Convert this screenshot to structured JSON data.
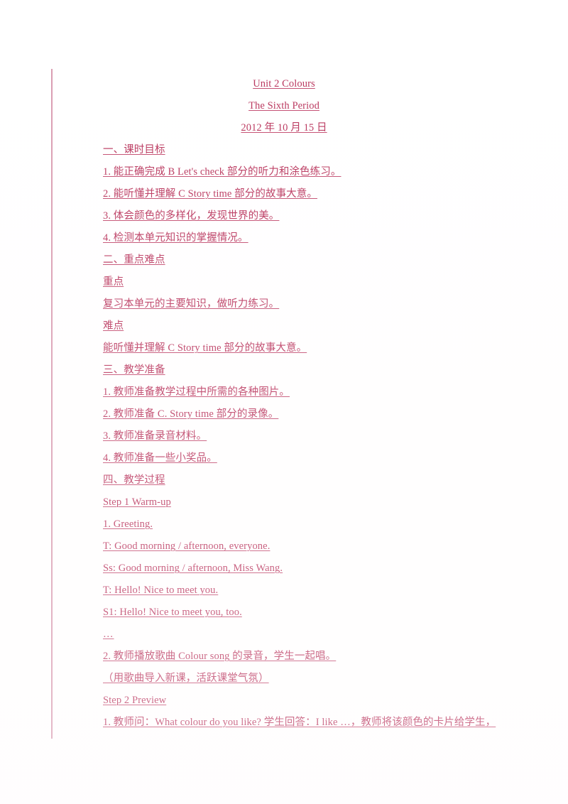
{
  "document": {
    "title_lines": [
      "Unit 2 Colours",
      "The Sixth Period",
      "2012 年 10 月 15 日"
    ],
    "body_lines": [
      "一、课时目标",
      "1. 能正确完成 B Let's check 部分的听力和涂色练习。",
      "2. 能听懂并理解 C Story time 部分的故事大意。",
      "3. 体会颜色的多样化，发现世界的美。",
      "4. 检测本单元知识的掌握情况。",
      "二、重点难点",
      "重点",
      "复习本单元的主要知识，做听力练习。",
      "难点",
      "能听懂并理解 C Story time 部分的故事大意。",
      "三、教学准备",
      "1. 教师准备教学过程中所需的各种图片。",
      "2. 教师准备 C. Story time 部分的录像。",
      "3. 教师准备录音材料。",
      "4. 教师准备一些小奖品。",
      "四、教学过程",
      "Step 1 Warm-up",
      "1. Greeting.",
      "T: Good morning / afternoon, everyone.",
      "Ss: Good morning / afternoon, Miss Wang.",
      "T: Hello! Nice to meet you.",
      "S1: Hello! Nice to meet you, too.",
      "…",
      "2. 教师播放歌曲 Colour song 的录音，学生一起唱。",
      "（用歌曲导入新课，活跃课堂气氛）",
      "Step 2 Preview",
      "1. 教师问：What colour do you like? 学生回答：I like …，教师将该颜色的卡片给学生，"
    ],
    "colors": {
      "text": "#b8325a",
      "underline": "#c24a6e",
      "change_bar": "#d99bb0",
      "paper": "#ffffff"
    }
  }
}
